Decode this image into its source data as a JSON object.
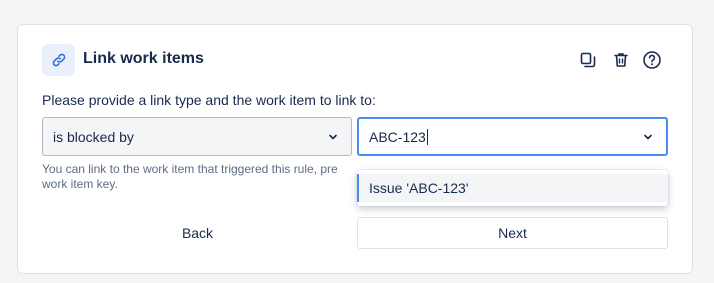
{
  "card": {
    "title": "Link work items",
    "prompt": "Please provide a link type and the work item to link to:",
    "helper": "You can link to the work item that triggered this rule, previously created work items, or by providing a work item key.",
    "helper_visible": "You can link to the work item that triggered this rule, pre",
    "helper_line2": "work item key."
  },
  "actions": {
    "duplicate_icon": "copy-icon",
    "delete_icon": "trash-icon",
    "help_icon": "help-icon"
  },
  "fields": {
    "link_type": {
      "value": "is blocked by"
    },
    "work_item": {
      "value": "ABC-123"
    }
  },
  "dropdown": {
    "options": [
      {
        "label": "Issue 'ABC-123'"
      }
    ]
  },
  "buttons": {
    "back": "Back",
    "next": "Next"
  },
  "colors": {
    "accent": "#4c8cf5",
    "icon_bg": "#e9f0fc",
    "text": "#172b4d",
    "muted": "#5e6c84"
  }
}
